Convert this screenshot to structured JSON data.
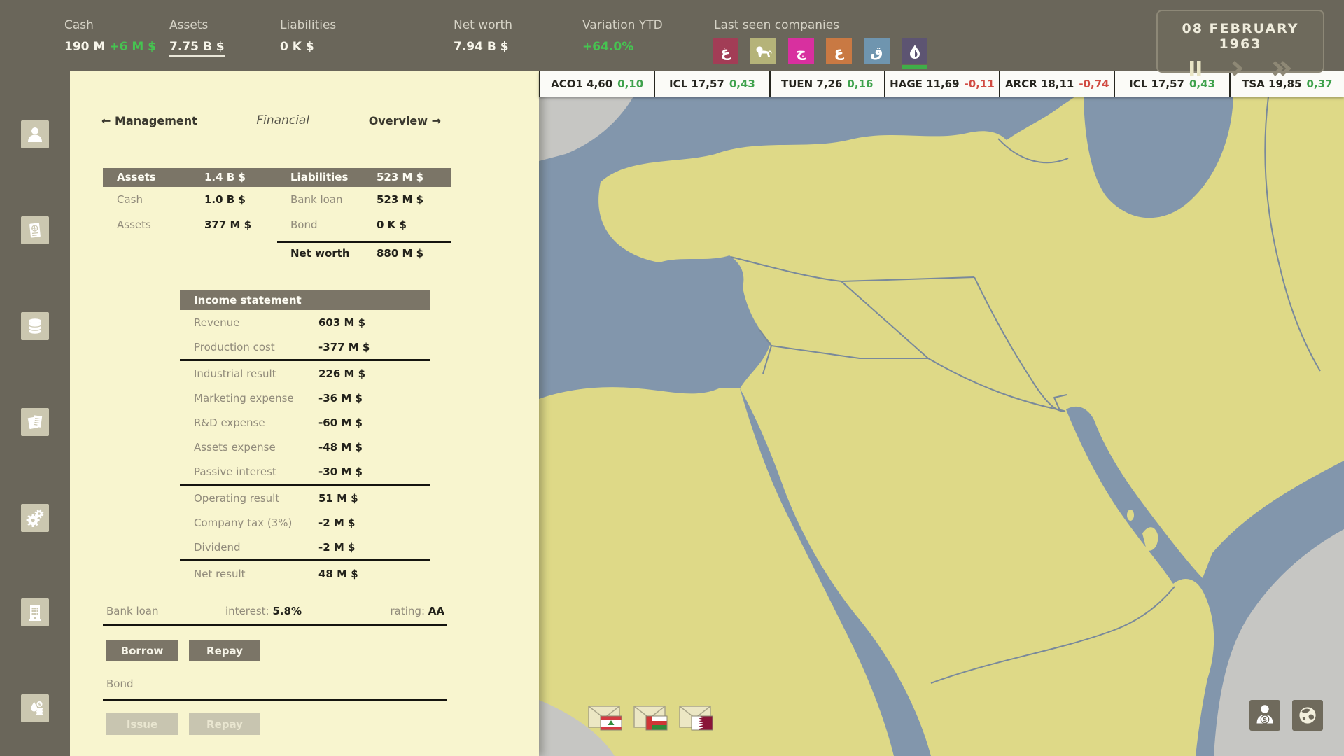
{
  "topbar": {
    "stats": [
      {
        "label": "Cash",
        "value": "190 M",
        "delta": "+6 M $"
      },
      {
        "label": "Assets",
        "value": "7.75 B $"
      },
      {
        "label": "Liabilities",
        "value": "0 K $"
      },
      {
        "label": "Net worth",
        "value": "7.94 B $"
      },
      {
        "label": "Variation YTD",
        "value": "+64.0%"
      }
    ],
    "last_seen_label": "Last seen companies",
    "companies": [
      {
        "icon": "arabic-letter-ghain",
        "glyph": "غ",
        "color": "#a23d56"
      },
      {
        "icon": "lion",
        "glyph": "",
        "color": "#b5b379"
      },
      {
        "icon": "arabic-letter-jeem",
        "glyph": "ج",
        "color": "#d8309f"
      },
      {
        "icon": "arabic-letter-ain",
        "glyph": "ع",
        "color": "#c97943"
      },
      {
        "icon": "arabic-letter-qaf",
        "glyph": "ق",
        "color": "#6f95af"
      },
      {
        "icon": "flame-drop",
        "glyph": "",
        "color": "#5d5472",
        "active": true,
        "active_underline_color": "#3fae49"
      }
    ],
    "date_panel": {
      "date": "08 FEBRUARY 1963",
      "paused": true
    }
  },
  "ticker": {
    "items": [
      {
        "name": "ACO1 4,60",
        "change": "0,10",
        "dir": "up"
      },
      {
        "name": "ICL 17,57",
        "change": "0,43",
        "dir": "up"
      },
      {
        "name": "TUEN 7,26",
        "change": "0,16",
        "dir": "up"
      },
      {
        "name": "HAGE 11,69",
        "change": "-0,11",
        "dir": "down"
      },
      {
        "name": "ARCR 18,11",
        "change": "-0,74",
        "dir": "down"
      },
      {
        "name": "ICL 17,57",
        "change": "0,43",
        "dir": "up"
      },
      {
        "name": "TSA 19,85",
        "change": "0,37",
        "dir": "up"
      }
    ]
  },
  "panel": {
    "nav": {
      "prev": "← Management",
      "current": "Financial",
      "next": "Overview →"
    },
    "balance": {
      "headers": {
        "assets_label": "Assets",
        "assets_value": "1.4 B $",
        "liabilities_label": "Liabilities",
        "liabilities_value": "523 M $"
      },
      "rows": [
        {
          "a_label": "Cash",
          "a_value": "1.0 B $",
          "l_label": "Bank loan",
          "l_value": "523 M $"
        },
        {
          "a_label": "Assets",
          "a_value": "377 M $",
          "l_label": "Bond",
          "l_value": "0 K $"
        }
      ],
      "net_worth": {
        "label": "Net worth",
        "value": "880 M $"
      }
    },
    "income_statement": {
      "title": "Income statement",
      "rows": [
        {
          "label": "Revenue",
          "value": "603 M $"
        },
        {
          "label": "Production cost",
          "value": "-377 M $"
        },
        {
          "label": "Industrial result",
          "value": "226 M $"
        },
        {
          "label": "Marketing expense",
          "value": "-36 M $"
        },
        {
          "label": "R&D expense",
          "value": "-60 M $"
        },
        {
          "label": "Assets expense",
          "value": "-48 M $"
        },
        {
          "label": "Passive interest",
          "value": "-30 M $"
        },
        {
          "label": "Operating result",
          "value": "51 M $"
        },
        {
          "label": "Company tax (3%)",
          "value": "-2 M $"
        },
        {
          "label": "Dividend",
          "value": "-2 M $"
        },
        {
          "label": "Net result",
          "value": "48 M $"
        }
      ]
    },
    "bank_loan": {
      "label": "Bank loan",
      "interest_label": "interest: ",
      "interest_value": "5.8%",
      "rating_label": "rating: ",
      "rating_value": "AA",
      "borrow_label": "Borrow",
      "repay_label": "Repay"
    },
    "bond": {
      "label": "Bond",
      "issue_label": "Issue",
      "repay_label": "Repay"
    }
  },
  "map": {
    "colors": {
      "sea": "#8296ac",
      "land_active": "#ded987",
      "land_inactive": "#c6c6c3",
      "border": "#79899b"
    },
    "messages": [
      {
        "flag": "lebanon"
      },
      {
        "flag": "oman"
      },
      {
        "flag": "qatar"
      }
    ]
  },
  "sidebar": {
    "items": [
      {
        "icon": "person"
      },
      {
        "icon": "contract"
      },
      {
        "icon": "database"
      },
      {
        "icon": "documents"
      },
      {
        "icon": "gears"
      },
      {
        "icon": "building"
      },
      {
        "icon": "oil-money"
      }
    ]
  }
}
